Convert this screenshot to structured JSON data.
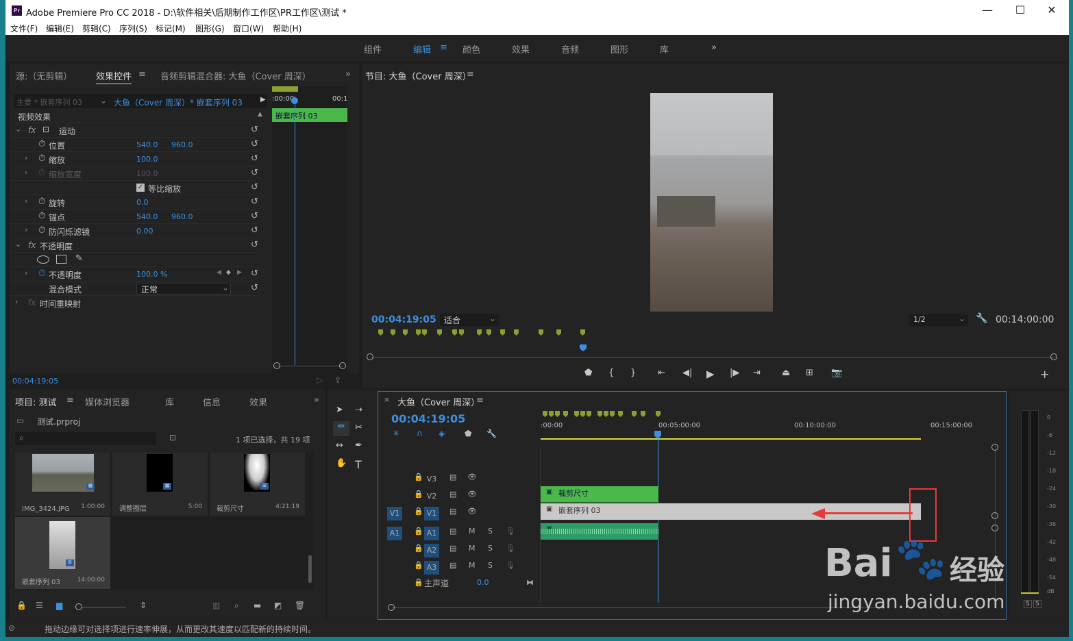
{
  "window": {
    "title": "Adobe Premiere Pro CC 2018 - D:\\软件相关\\后期制作工作区\\PR工作区\\测试 *",
    "logo": "Pr",
    "minimize": "—",
    "maximize": "☐",
    "close": "✕"
  },
  "menu": [
    "文件(F)",
    "编辑(E)",
    "剪辑(C)",
    "序列(S)",
    "标记(M)",
    "图形(G)",
    "窗口(W)",
    "帮助(H)"
  ],
  "workspaces": [
    "组件",
    "编辑",
    "颜色",
    "效果",
    "音频",
    "图形",
    "库"
  ],
  "workspace_active": "编辑",
  "source_panel": {
    "tabs": [
      "源:（无剪辑）",
      "效果控件",
      "音频剪辑混合器: 大鱼（Cover 周深）"
    ],
    "master": "主要 * 嵌套序列 03",
    "clip": "大鱼（Cover 周深）* 嵌套序列 03",
    "ruler_start": ":00:00",
    "ruler_end": "00:1",
    "clip_name": "嵌套序列 03",
    "section": "视频效果",
    "motion": "运动",
    "position_label": "位置",
    "position_x": "540.0",
    "position_y": "960.0",
    "scale_label": "缩放",
    "scale_value": "100.0",
    "scale_width_label": "缩放宽度",
    "scale_width_value": "100.0",
    "uniform_label": "等比缩放",
    "rotation_label": "旋转",
    "rotation_value": "0.0",
    "anchor_label": "锚点",
    "anchor_x": "540.0",
    "anchor_y": "960.0",
    "flicker_label": "防闪烁滤镜",
    "flicker_value": "0.00",
    "opacity_section": "不透明度",
    "opacity_label": "不透明度",
    "opacity_value": "100.0 %",
    "blend_label": "混合模式",
    "blend_value": "正常",
    "time_remap": "时间重映射",
    "timecode": "00:04:19:05"
  },
  "program": {
    "title": "节目: 大鱼（Cover 周深）",
    "timecode": "00:04:19:05",
    "fit": "适合",
    "resolution": "1/2",
    "duration": "00:14:00:00"
  },
  "project": {
    "tabs": [
      "项目: 测试",
      "媒体浏览器",
      "库",
      "信息",
      "效果"
    ],
    "file": "测试.prproj",
    "count": "1 项已选择，共 19 项",
    "items": [
      {
        "name": "IMG_3424.JPG",
        "dur": "1:00:00"
      },
      {
        "name": "调整图层",
        "dur": "5:00"
      },
      {
        "name": "裁剪尺寸",
        "dur": "4:21:19"
      },
      {
        "name": "嵌套序列 03",
        "dur": "14:00:00"
      }
    ]
  },
  "timeline": {
    "title": "大鱼（Cover 周深）",
    "timecode": "00:04:19:05",
    "ruler": [
      ":00:00",
      "00:05:00:00",
      "00:10:00:00",
      "00:15:00:00"
    ],
    "tracks": [
      "V3",
      "V2",
      "V1",
      "A1",
      "A2",
      "A3"
    ],
    "source_v": "V1",
    "source_a": "A1",
    "master_label": "主声道",
    "master_value": "0.0",
    "clip_v2": "裁剪尺寸",
    "clip_v1": "嵌套序列 03",
    "m": "M",
    "s": "S"
  },
  "meter": [
    "0",
    "-6",
    "-12",
    "-18",
    "-24",
    "-30",
    "-36",
    "-42",
    "-48",
    "-54",
    "dB"
  ],
  "status": "拖动边缘可对选择项进行速率伸展，从而更改其速度以匹配新的持续时间。",
  "watermark": {
    "brand": "Bai",
    "brand2": "经验",
    "url": "jingyan.baidu.com"
  },
  "colors": {
    "accent": "#3d8fe0",
    "clip_green": "#4bb84b",
    "audio_green": "#2f9c68",
    "highlight": "#e83a3a"
  }
}
